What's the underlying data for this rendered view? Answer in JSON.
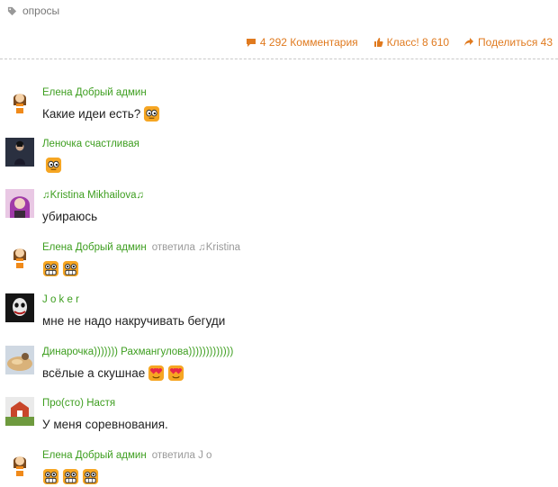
{
  "tag": {
    "icon": "tag-icon",
    "label": "опросы"
  },
  "actions": {
    "comments": {
      "icon": "comment-icon",
      "label": "4 292 Комментария"
    },
    "like": {
      "icon": "klass-hand-icon",
      "label": "Класс! 8 610"
    },
    "share": {
      "icon": "share-arrow-icon",
      "label": "Поделиться 43"
    }
  },
  "comments": [
    {
      "author": "Елена Добрый админ",
      "replied": "",
      "text": "Какие идеи есть?",
      "smileys": [
        "smiley-eyes-icon"
      ]
    },
    {
      "author": "Леночка счастливая",
      "replied": "",
      "text": "",
      "smileys": [
        "smiley-eyes-icon"
      ]
    },
    {
      "author": "♫Kristina Mikhailova♫",
      "replied": "",
      "text": "убираюсь",
      "smileys": []
    },
    {
      "author": "Елена Добрый админ",
      "replied": "ответила ♫Kristina",
      "text": "",
      "smileys": [
        "smiley-grin-icon",
        "smiley-grin-icon"
      ]
    },
    {
      "author": "J o k e r",
      "replied": "",
      "text": "мне не надо накручивать бегуди",
      "smileys": []
    },
    {
      "author": "Динарочка))))))) Рахмангулова)))))))))))))",
      "replied": "",
      "text": "всёлые а скушнае",
      "smileys": [
        "smiley-heart-eyes-icon",
        "smiley-heart-eyes-icon"
      ]
    },
    {
      "author": "Про(сто) Настя",
      "replied": "",
      "text": "У меня соревнования.",
      "smileys": []
    },
    {
      "author": "Елена Добрый админ",
      "replied": "ответила J o",
      "text": "",
      "smileys": [
        "smiley-grin-icon",
        "smiley-grin-icon",
        "smiley-grin-icon"
      ]
    }
  ],
  "colors": {
    "accent": "#e07a1f",
    "author": "#3d9e1f",
    "muted": "#999999"
  }
}
